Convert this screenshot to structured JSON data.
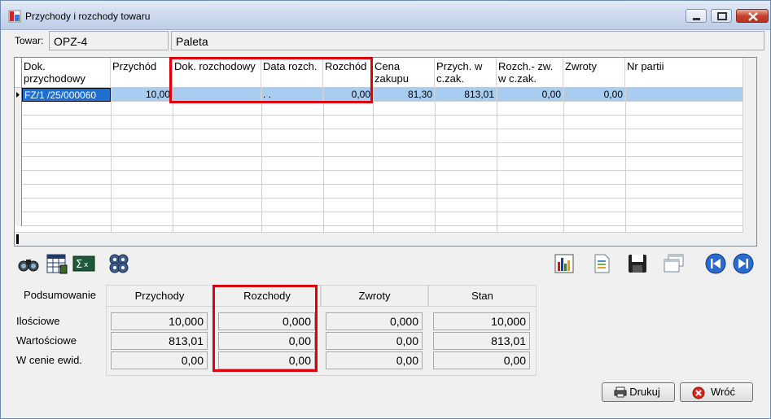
{
  "window": {
    "title": "Przychody i rozchody towaru"
  },
  "towar": {
    "label": "Towar:",
    "code": "OPZ-4",
    "name": "Paleta"
  },
  "grid": {
    "columns": [
      "Dok. przychodowy",
      "Przychód",
      "Dok. rozchodowy",
      "Data rozch.",
      "Rozchód",
      "Cena zakupu",
      "Przych. w c.zak.",
      "Rozch.- zw. w c.zak.",
      "Zwroty",
      "Nr partii"
    ],
    "rows": [
      {
        "dok_przych": "FZ/1  /25/000060",
        "przychod": "10,00",
        "dok_rozch": "",
        "data_rozch": ". .",
        "rozchod": "0,00",
        "cena_zakupu": "81,30",
        "przych_czak": "813,01",
        "rozch_zw_czak": "0,00",
        "zwroty": "0,00",
        "nr_partii": ""
      }
    ]
  },
  "toolbar": {
    "left": [
      "binoculars-icon",
      "calculator-grid-icon",
      "sum-icon",
      "gears-icon"
    ],
    "right": [
      "chart-icon",
      "document-icon",
      "save-icon",
      "windows-icon",
      "first-record-icon",
      "last-record-icon"
    ]
  },
  "summary": {
    "header": "Podsumowanie",
    "columns": [
      "Przychody",
      "Rozchody",
      "Zwroty",
      "Stan"
    ],
    "rows": [
      {
        "label": "Ilościowe",
        "values": [
          "10,000",
          "0,000",
          "0,000",
          "10,000"
        ]
      },
      {
        "label": "Wartościowe",
        "values": [
          "813,01",
          "0,00",
          "0,00",
          "813,01"
        ]
      },
      {
        "label": "W cenie ewid.",
        "values": [
          "0,00",
          "0,00",
          "0,00",
          "0,00"
        ]
      }
    ]
  },
  "buttons": {
    "print": "Drukuj",
    "back": "Wróć"
  },
  "colors": {
    "highlight": "#e0000b",
    "selected_row": "#a9cdf0",
    "title_bar": "#cfdcee"
  }
}
